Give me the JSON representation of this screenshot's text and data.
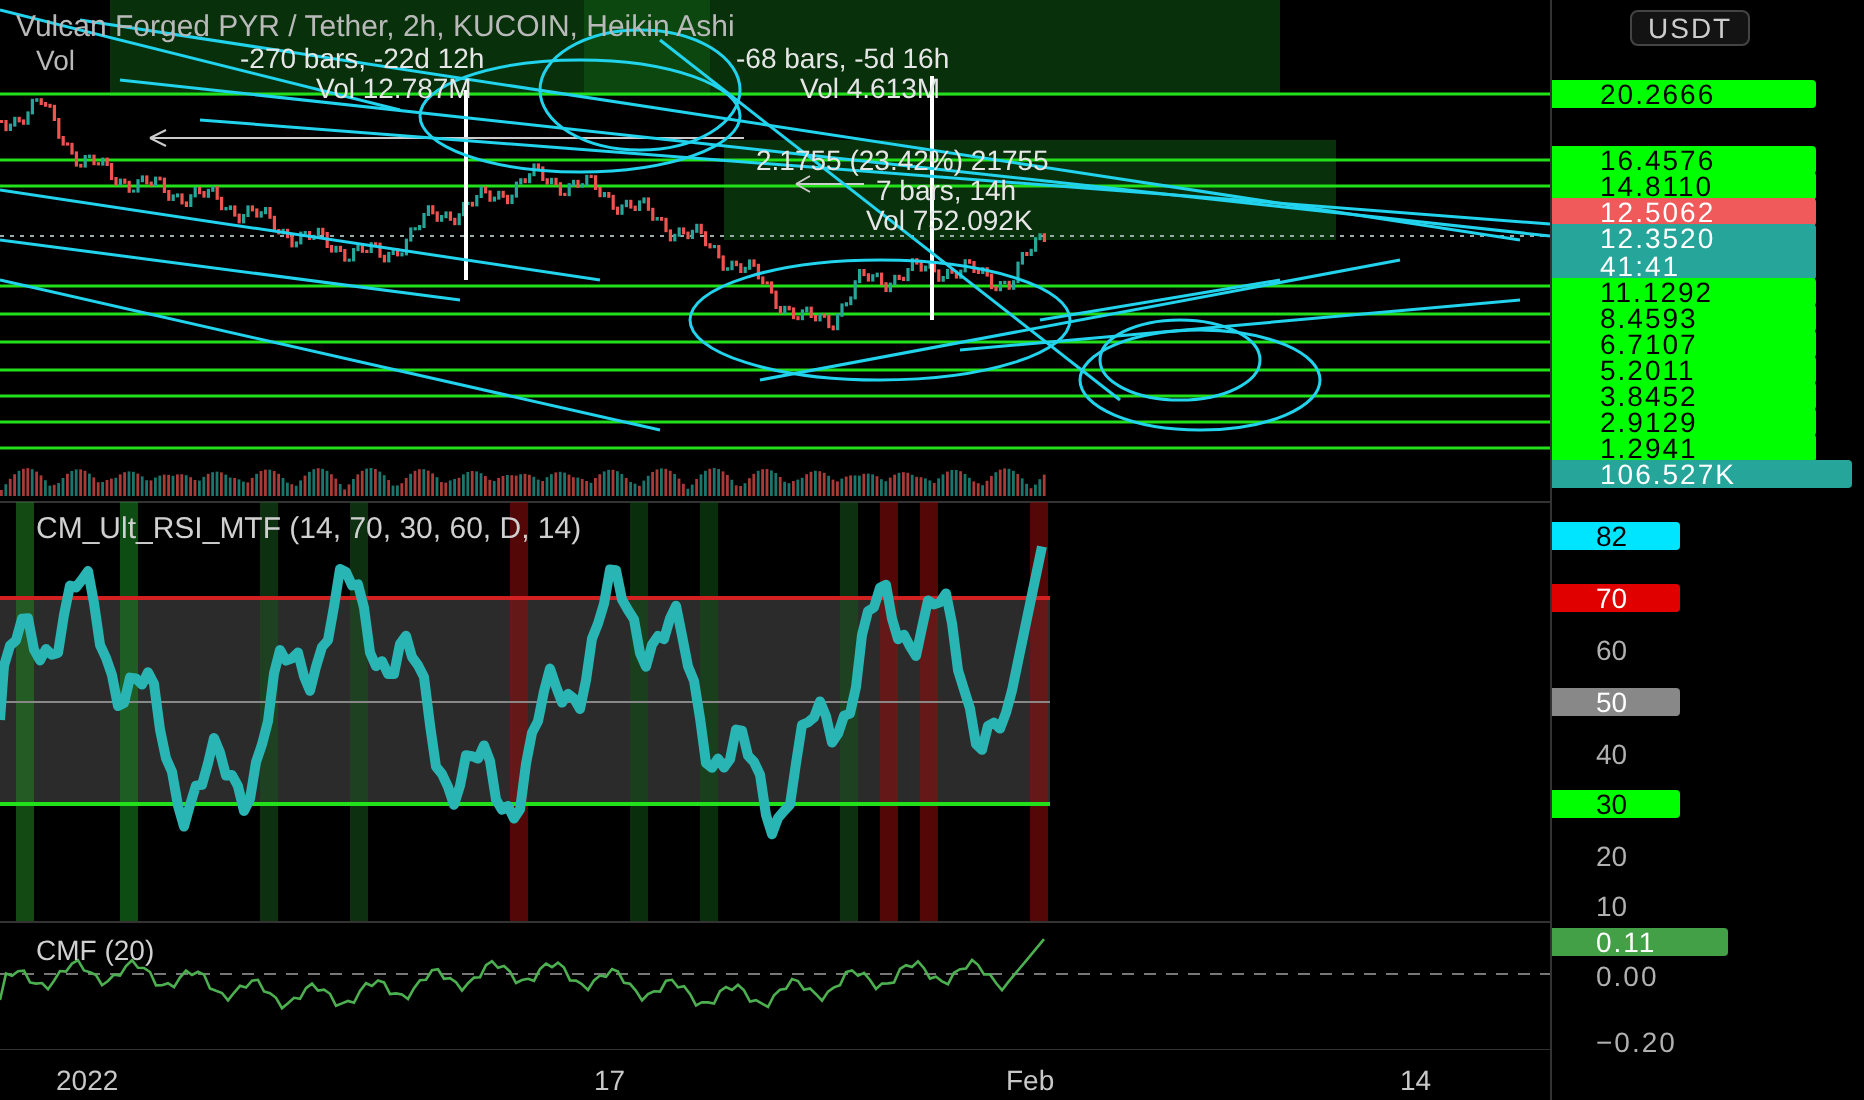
{
  "chart": {
    "title": "Vulcan Forged PYR / Tether, 2h, KUCOIN, Heikin Ashi",
    "volume_legend": "Vol",
    "measurements": [
      {
        "range": "-270 bars, -22d 12h",
        "volume": "Vol 12.787M"
      },
      {
        "range": "-68 bars, -5d 16h",
        "volume": "Vol 4.613M"
      },
      {
        "change": "2.1755 (23.42%) 21755",
        "range": "7 bars, 14h",
        "volume": "Vol 752.092K"
      }
    ]
  },
  "price_axis": {
    "currency": "USDT",
    "labels": [
      {
        "text": "20.2666",
        "kind": "level"
      },
      {
        "text": "16.4576",
        "kind": "level"
      },
      {
        "text": "14.8110",
        "kind": "level"
      },
      {
        "text": "12.5062",
        "kind": "last"
      },
      {
        "text": "12.3520",
        "countdown": "41:41",
        "kind": "current"
      },
      {
        "text": "11.1292",
        "kind": "level"
      },
      {
        "text": "8.4593",
        "kind": "level"
      },
      {
        "text": "6.7107",
        "kind": "level"
      },
      {
        "text": "5.2011",
        "kind": "level"
      },
      {
        "text": "3.8452",
        "kind": "level"
      },
      {
        "text": "2.9129",
        "kind": "level"
      },
      {
        "text": "1.2941",
        "kind": "level"
      },
      {
        "text": "106.527K",
        "kind": "volume"
      }
    ]
  },
  "rsi": {
    "legend": "CM_Ult_RSI_MTF (14, 70, 30, 60, D, 14)",
    "labels": [
      {
        "text": "82",
        "kind": "value"
      },
      {
        "text": "70",
        "kind": "upper"
      },
      {
        "text": "60",
        "kind": "tick"
      },
      {
        "text": "50",
        "kind": "middle"
      },
      {
        "text": "40",
        "kind": "tick"
      },
      {
        "text": "30",
        "kind": "lower"
      },
      {
        "text": "20",
        "kind": "tick"
      },
      {
        "text": "10",
        "kind": "tick"
      }
    ]
  },
  "cmf": {
    "legend": "CMF (20)",
    "labels": [
      {
        "text": "0.11",
        "kind": "value"
      },
      {
        "text": "0.00",
        "kind": "tick"
      },
      {
        "text": "−0.20",
        "kind": "tick"
      }
    ]
  },
  "time_axis": [
    "2022",
    "17",
    "Feb",
    "14"
  ]
}
